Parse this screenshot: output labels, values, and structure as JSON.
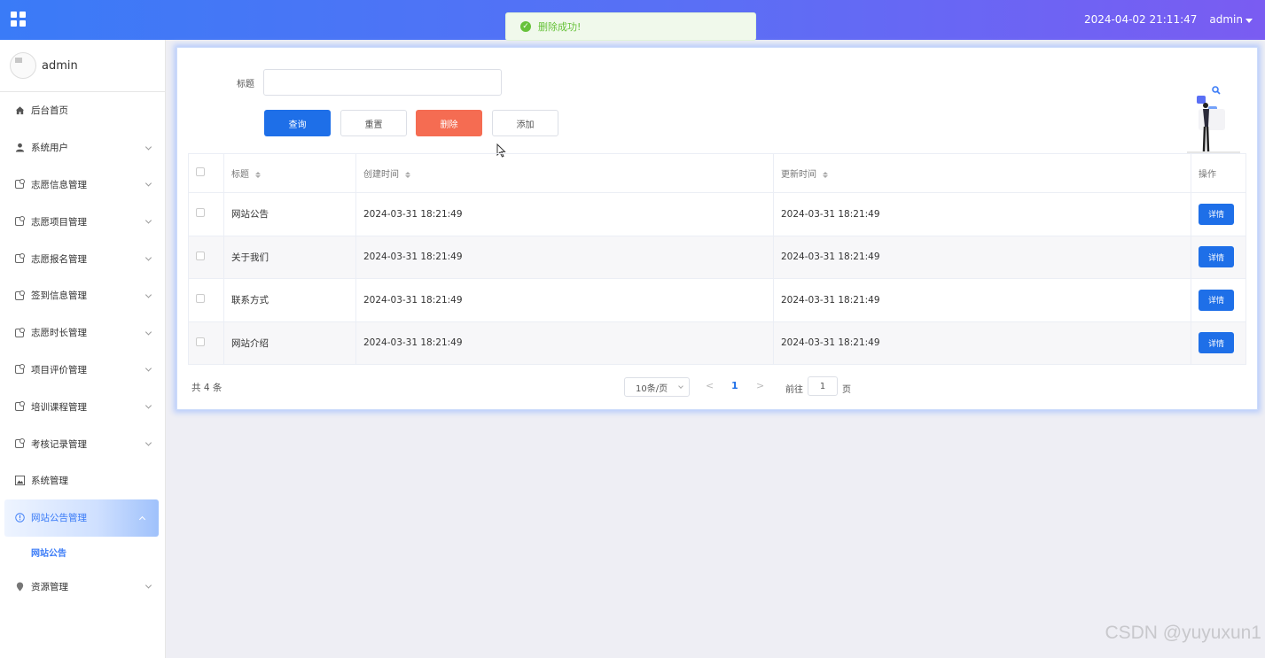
{
  "header": {
    "datetime": "2024-04-02 21:11:47",
    "user": "admin",
    "gradient_start": "#3a7bf7",
    "gradient_end": "#7a5cf2"
  },
  "toast": {
    "message": "删除成功!",
    "color": "#67c23a"
  },
  "sidebar": {
    "username": "admin",
    "items": [
      {
        "label": "后台首页",
        "icon": "home-icon"
      },
      {
        "label": "系统用户",
        "icon": "user-icon"
      },
      {
        "label": "志愿信息管理",
        "icon": "box-icon"
      },
      {
        "label": "志愿项目管理",
        "icon": "box-icon"
      },
      {
        "label": "志愿报名管理",
        "icon": "box-icon"
      },
      {
        "label": "签到信息管理",
        "icon": "box-icon"
      },
      {
        "label": "志愿时长管理",
        "icon": "box-icon"
      },
      {
        "label": "项目评价管理",
        "icon": "box-icon"
      },
      {
        "label": "培训课程管理",
        "icon": "box-icon"
      },
      {
        "label": "考核记录管理",
        "icon": "box-icon"
      },
      {
        "label": "系统管理",
        "icon": "image-icon"
      },
      {
        "label": "网站公告管理",
        "icon": "info-icon"
      },
      {
        "label": "资源管理",
        "icon": "location-icon"
      }
    ],
    "submenu": {
      "label": "网站公告"
    }
  },
  "search": {
    "label": "标题",
    "value": "",
    "placeholder": ""
  },
  "buttons": {
    "query": "查询",
    "reset": "重置",
    "delete": "删除",
    "add": "添加"
  },
  "table": {
    "headers": {
      "title": "标题",
      "created": "创建时间",
      "updated": "更新时间",
      "actions": "操作"
    },
    "rows": [
      {
        "title": "网站公告",
        "created": "2024-03-31 18:21:49",
        "updated": "2024-03-31 18:21:49",
        "action": "详情"
      },
      {
        "title": "关于我们",
        "created": "2024-03-31 18:21:49",
        "updated": "2024-03-31 18:21:49",
        "action": "详情"
      },
      {
        "title": "联系方式",
        "created": "2024-03-31 18:21:49",
        "updated": "2024-03-31 18:21:49",
        "action": "详情"
      },
      {
        "title": "网站介绍",
        "created": "2024-03-31 18:21:49",
        "updated": "2024-03-31 18:21:49",
        "action": "详情"
      }
    ]
  },
  "pagination": {
    "total": "共 4 条",
    "page_size": "10条/页",
    "current_page": "1",
    "goto_label": "前往",
    "goto_value": "1",
    "goto_suffix": "页"
  },
  "watermark": "CSDN @yuyuxun1"
}
